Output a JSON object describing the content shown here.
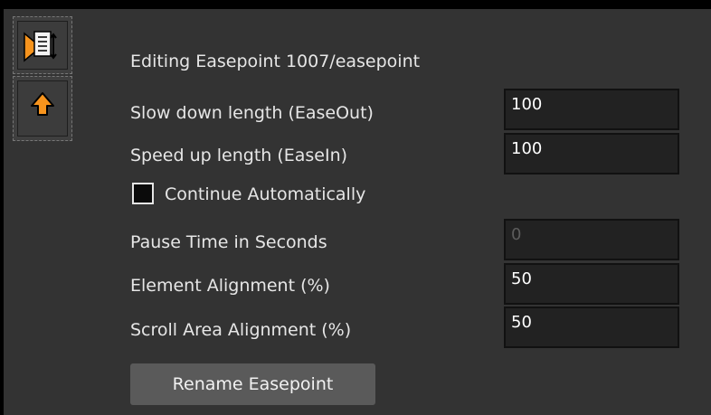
{
  "header": {
    "title": "Editing Easepoint 1007/easepoint"
  },
  "toolbar": {
    "items": [
      {
        "icon": "toggle-script-icon"
      },
      {
        "icon": "move-up-icon"
      }
    ]
  },
  "form": {
    "ease_out": {
      "label": "Slow down length (EaseOut)",
      "value": "100"
    },
    "ease_in": {
      "label": "Speed up length (EaseIn)",
      "value": "100"
    },
    "continue_auto": {
      "label": "Continue Automatically",
      "checked": false
    },
    "pause_time": {
      "label": "Pause Time in Seconds",
      "value": "0"
    },
    "element_alignment": {
      "label": "Element Alignment (%)",
      "value": "50"
    },
    "scroll_alignment": {
      "label": "Scroll Area Alignment (%)",
      "value": "50"
    }
  },
  "actions": {
    "rename_label": "Rename Easepoint"
  },
  "colors": {
    "panel_bg": "#333333",
    "field_bg": "#222222",
    "icon_orange": "#f7941d",
    "text": "#e6e6e6"
  }
}
